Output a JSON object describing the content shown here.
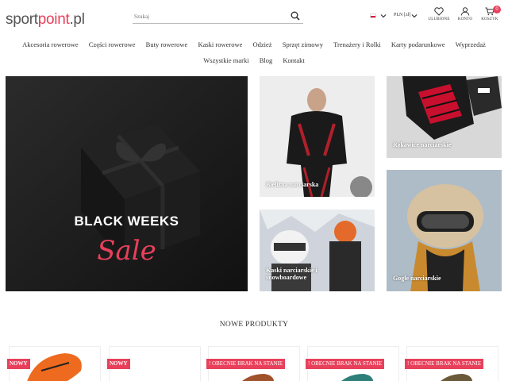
{
  "header": {
    "logo": {
      "part1": "sport",
      "part2": "point",
      "part3": ".pl"
    },
    "search": {
      "placeholder": "Szukaj"
    },
    "language": {
      "flag": "poland-flag"
    },
    "currency": "PLN [zł]",
    "icons": {
      "favorites_label": "ULUBIONE",
      "account_label": "KONTO",
      "cart_label": "KOSZYK",
      "cart_count": "0"
    }
  },
  "nav": {
    "row1": [
      "Akcesoria rowerowe",
      "Części rowerowe",
      "Buty rowerowe",
      "Kaski rowerowe",
      "Odzież",
      "Sprzęt zimowy",
      "Trenażery i Rolki",
      "Karty podarunkowe",
      "Wyprzedaż"
    ],
    "row2": [
      "Wszystkie marki",
      "Blog",
      "Kontakt"
    ]
  },
  "banners": {
    "main": {
      "title": "BLACK WEEKS",
      "subtitle": "Sale"
    },
    "bielizna": "Bielizna narciarska",
    "kaski_line1": "Kaski narciarskie i",
    "kaski_line2": "snowboardowe",
    "rekawice": "Rękawice narciarskie",
    "gogle": "Gogle narciarskie"
  },
  "new_products": {
    "title": "NOWE PRODUKTY",
    "badges": [
      "NOWY",
      "NOWY",
      "! OBECNIE BRAK NA STANIE",
      "! OBECNIE BRAK NA STANIE",
      "! OBECNIE BRAK NA STANIE"
    ]
  },
  "colors": {
    "accent": "#e8405b",
    "text": "#333333"
  }
}
